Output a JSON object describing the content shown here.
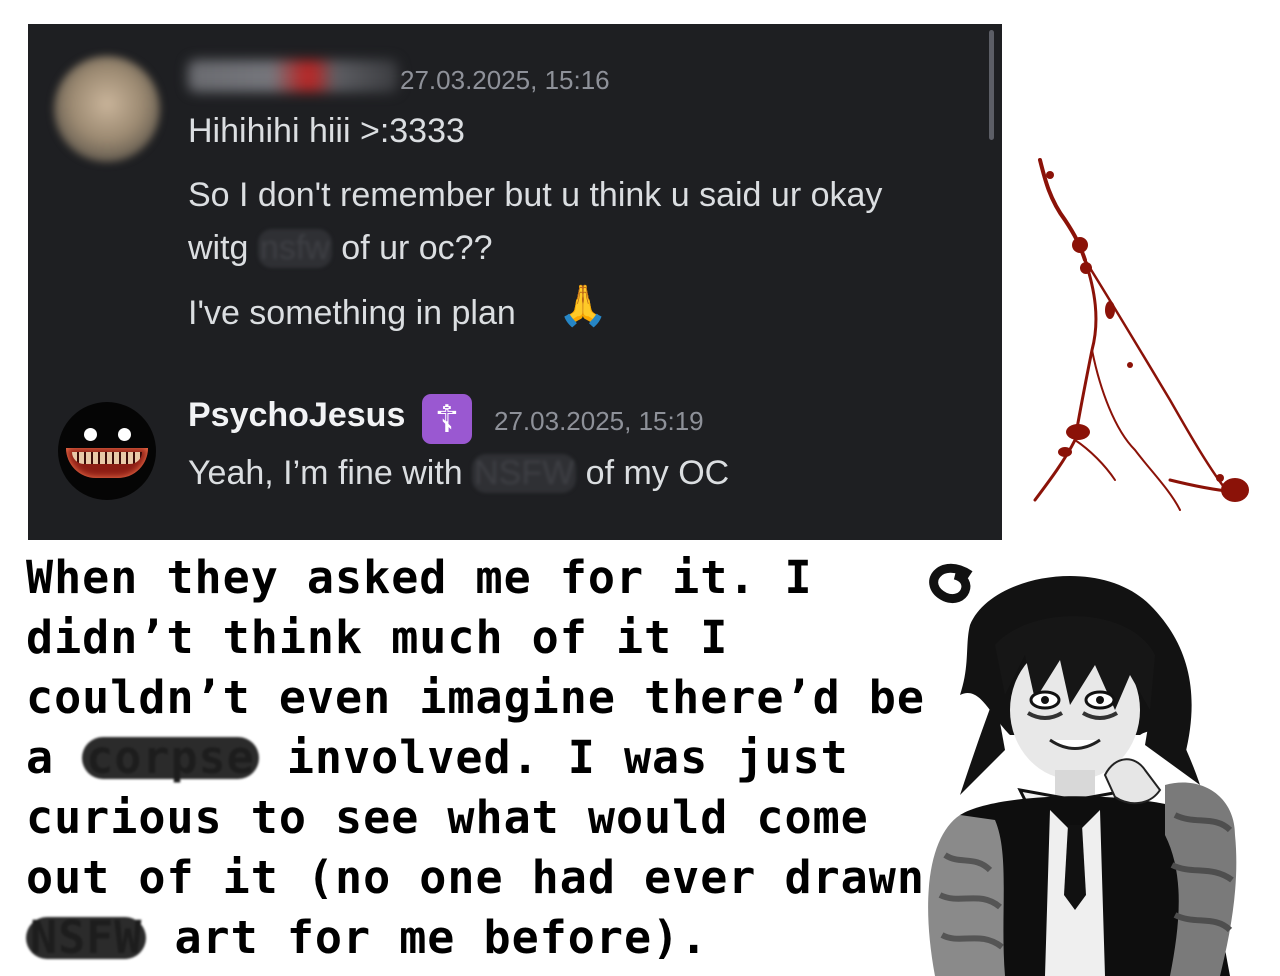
{
  "chat": {
    "message1": {
      "timestamp": "27.03.2025, 15:16",
      "lines": [
        "Hihihihi hiii >:3333",
        "So I don't remember but u think u said ur okay",
        "I've something in plan"
      ],
      "line3_pre": "witg ",
      "line3_censored": "nsfw",
      "line3_post": " of ur oc??",
      "emoji": "🙏"
    },
    "message2": {
      "username": "PsychoJesus",
      "role_badge": "☦",
      "timestamp": "27.03.2025, 15:19",
      "text_pre": "Yeah, I’m fine with ",
      "text_censored": "NSFW",
      "text_post": " of my OC"
    }
  },
  "caption": {
    "lines": [
      "When they asked me for it. I",
      "didn’t think much of it   I",
      "couldn’t even imagine there’d be"
    ],
    "line4_pre": "a ",
    "line4_censored": "corpse",
    "line4_post": " involved. I was just",
    "line5": "curious to see what would come",
    "line6": "out of it (no one had ever drawn",
    "line7_censored": "NSFW",
    "line7_post": " art for me before)."
  },
  "colors": {
    "chat_background": "#1e1f22",
    "role_badge": "#9a58d1",
    "blood": "#8b1208"
  }
}
